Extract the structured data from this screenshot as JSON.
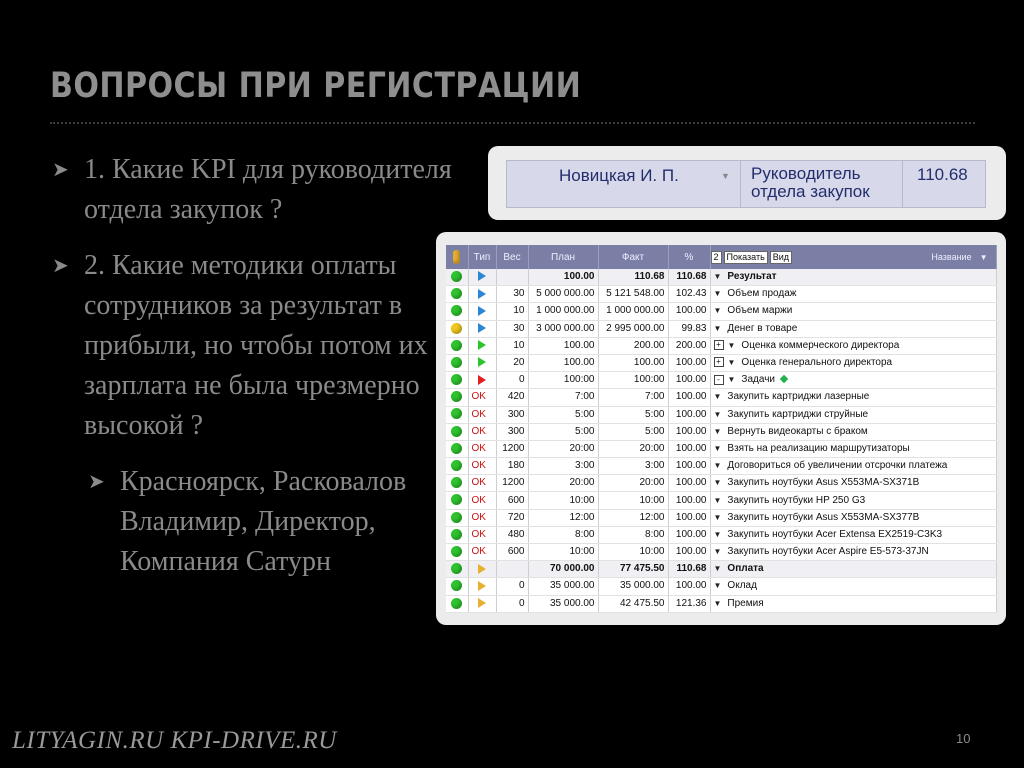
{
  "slide": {
    "title": "ВОПРОСЫ ПРИ РЕГИСТРАЦИИ",
    "bullets": [
      "1. Какие KPI для руководителя отдела закупок ?",
      "2. Какие методики оплаты сотрудников за результат в прибыли, но чтобы потом их зарплата не была чрезмерно высокой ?"
    ],
    "sub_bullet": "Красноярск, Расковалов Владимир, Директор, Компания Сатурн",
    "footer": "LITYAGIN.RU  KPI-DRIVE.RU",
    "page_number": "10"
  },
  "employee_card": {
    "name": "Новицкая И. П.",
    "role": "Руководитель отдела закупок",
    "score": "110.68"
  },
  "table": {
    "headers": {
      "type": "Тип",
      "weight": "Вес",
      "plan": "План",
      "fact": "Факт",
      "percent": "%",
      "show_num": "2",
      "show": "Показать",
      "view": "Вид",
      "name": "Название"
    },
    "colors": {
      "green": "#2ec42e",
      "yellow": "#f2c81e",
      "blue": "#2b86d4",
      "red": "#e02020",
      "orange": "#e8b030"
    },
    "rows": [
      {
        "status": "green",
        "type": "blue",
        "weight": "",
        "plan": "100.00",
        "fact": "110.68",
        "pct": "110.68",
        "name": "Результат",
        "bold": true,
        "lvl": 1,
        "exp": ""
      },
      {
        "status": "green",
        "type": "blue",
        "weight": "30",
        "plan": "5 000 000.00",
        "fact": "5 121 548.00",
        "pct": "102.43",
        "name": "Объем продаж",
        "lvl": 2,
        "exp": ""
      },
      {
        "status": "green",
        "type": "blue",
        "weight": "10",
        "plan": "1 000 000.00",
        "fact": "1 000 000.00",
        "pct": "100.00",
        "name": "Объем маржи",
        "lvl": 2,
        "exp": ""
      },
      {
        "status": "yellow",
        "type": "blue",
        "weight": "30",
        "plan": "3 000 000.00",
        "fact": "2 995 000.00",
        "pct": "99.83",
        "name": "Денег в товаре",
        "lvl": 2,
        "exp": ""
      },
      {
        "status": "green",
        "type": "green",
        "weight": "10",
        "plan": "100.00",
        "fact": "200.00",
        "pct": "200.00",
        "name": "Оценка коммерческого директора",
        "lvl": 2,
        "exp": "+"
      },
      {
        "status": "green",
        "type": "green",
        "weight": "20",
        "plan": "100.00",
        "fact": "100.00",
        "pct": "100.00",
        "name": "Оценка генерального директора",
        "lvl": 2,
        "exp": "+"
      },
      {
        "status": "green",
        "type": "red",
        "weight": "0",
        "plan": "100:00",
        "fact": "100:00",
        "pct": "100.00",
        "name": "Задачи",
        "lvl": 2,
        "exp": "-",
        "diamond": true
      },
      {
        "status": "green",
        "type": "OK",
        "weight": "420",
        "plan": "7:00",
        "fact": "7:00",
        "pct": "100.00",
        "name": "Закупить картриджи лазерные",
        "lvl": 3,
        "exp": ""
      },
      {
        "status": "green",
        "type": "OK",
        "weight": "300",
        "plan": "5:00",
        "fact": "5:00",
        "pct": "100.00",
        "name": "Закупить картриджи струйные",
        "lvl": 3,
        "exp": ""
      },
      {
        "status": "green",
        "type": "OK",
        "weight": "300",
        "plan": "5:00",
        "fact": "5:00",
        "pct": "100.00",
        "name": "Вернуть видеокарты с браком",
        "lvl": 3,
        "exp": ""
      },
      {
        "status": "green",
        "type": "OK",
        "weight": "1200",
        "plan": "20:00",
        "fact": "20:00",
        "pct": "100.00",
        "name": "Взять на реализацию маршрутизаторы",
        "lvl": 3,
        "exp": ""
      },
      {
        "status": "green",
        "type": "OK",
        "weight": "180",
        "plan": "3:00",
        "fact": "3:00",
        "pct": "100.00",
        "name": "Договориться об увеличении отсрочки платежа",
        "lvl": 3,
        "exp": ""
      },
      {
        "status": "green",
        "type": "OK",
        "weight": "1200",
        "plan": "20:00",
        "fact": "20:00",
        "pct": "100.00",
        "name": "Закупить ноутбуки Asus X553MA-SX371B",
        "lvl": 3,
        "exp": ""
      },
      {
        "status": "green",
        "type": "OK",
        "weight": "600",
        "plan": "10:00",
        "fact": "10:00",
        "pct": "100.00",
        "name": "Закупить ноутбуки HP 250 G3",
        "lvl": 3,
        "exp": ""
      },
      {
        "status": "green",
        "type": "OK",
        "weight": "720",
        "plan": "12:00",
        "fact": "12:00",
        "pct": "100.00",
        "name": "Закупить ноутбуки Asus X553MA-SX377B",
        "lvl": 3,
        "exp": ""
      },
      {
        "status": "green",
        "type": "OK",
        "weight": "480",
        "plan": "8:00",
        "fact": "8:00",
        "pct": "100.00",
        "name": "Закупить ноутбуки Acer Extensa EX2519-C3K3",
        "lvl": 3,
        "exp": ""
      },
      {
        "status": "green",
        "type": "OK",
        "weight": "600",
        "plan": "10:00",
        "fact": "10:00",
        "pct": "100.00",
        "name": "Закупить ноутбуки Acer Aspire E5-573-37JN",
        "lvl": 3,
        "exp": ""
      },
      {
        "status": "green",
        "type": "orange",
        "weight": "",
        "plan": "70 000.00",
        "fact": "77 475.50",
        "pct": "110.68",
        "name": "Оплата",
        "bold": true,
        "lvl": 1,
        "exp": ""
      },
      {
        "status": "green",
        "type": "orange",
        "weight": "0",
        "plan": "35 000.00",
        "fact": "35 000.00",
        "pct": "100.00",
        "name": "Оклад",
        "lvl": 2,
        "exp": ""
      },
      {
        "status": "green",
        "type": "orange",
        "weight": "0",
        "plan": "35 000.00",
        "fact": "42 475.50",
        "pct": "121.36",
        "name": "Премия",
        "lvl": 2,
        "exp": ""
      }
    ]
  }
}
